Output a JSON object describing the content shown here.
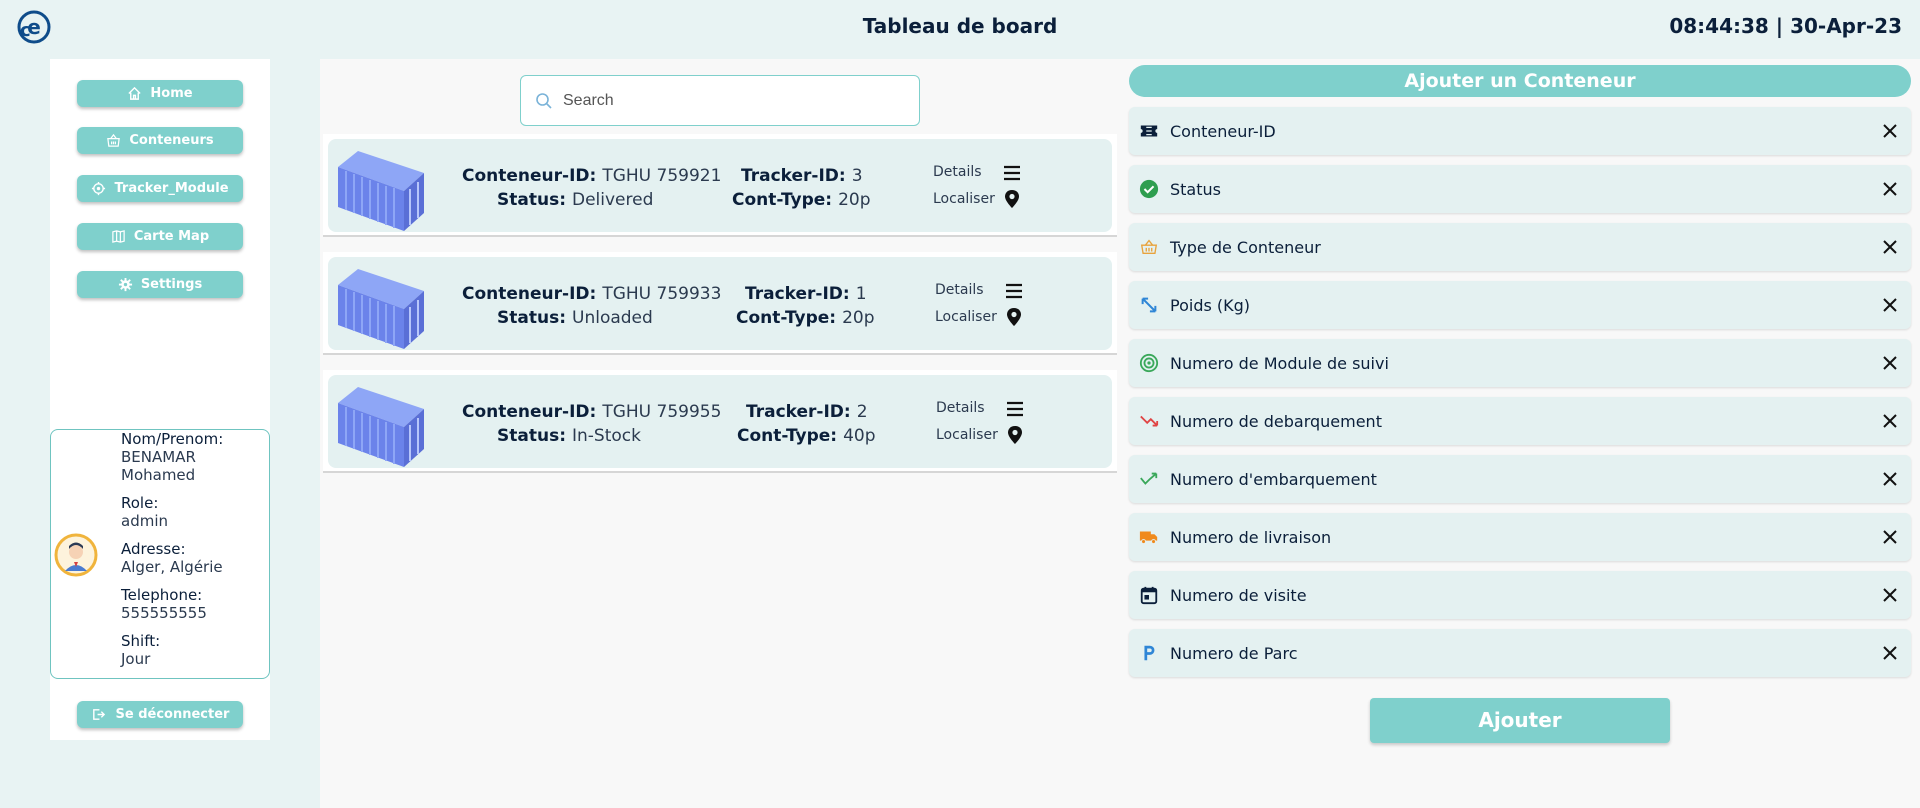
{
  "header": {
    "title": "Tableau de board",
    "clock": "08:44:38 | 30-Apr-23"
  },
  "sidebar": {
    "nav": [
      {
        "label": "Home",
        "icon": "home-icon"
      },
      {
        "label": "Conteneurs",
        "icon": "basket-icon"
      },
      {
        "label": "Tracker_Module",
        "icon": "target-icon"
      },
      {
        "label": "Carte Map",
        "icon": "map-icon"
      },
      {
        "label": "Settings",
        "icon": "gear-icon"
      }
    ],
    "profile": {
      "name_label": "Nom/Prenom:",
      "name_value": "BENAMAR Mohamed",
      "role_label": "Role:",
      "role_value": "admin",
      "address_label": "Adresse:",
      "address_value": "Alger, Algérie",
      "phone_label": "Telephone:",
      "phone_value": "555555555",
      "shift_label": "Shift:",
      "shift_value": "Jour"
    },
    "logout_label": "Se déconnecter"
  },
  "search": {
    "placeholder": "Search"
  },
  "containers": {
    "id_label": "Conteneur-ID:",
    "status_label": "Status:",
    "tracker_label": "Tracker-ID:",
    "type_label": "Cont-Type:",
    "details_label": "Details",
    "locate_label": "Localiser",
    "items": [
      {
        "id": "TGHU 759921",
        "status": "Delivered",
        "tracker": "3",
        "type": "20p"
      },
      {
        "id": "TGHU 759933",
        "status": "Unloaded",
        "tracker": "1",
        "type": "20p"
      },
      {
        "id": "TGHU 759955",
        "status": "In-Stock",
        "tracker": "2",
        "type": "40p"
      }
    ]
  },
  "form": {
    "title": "Ajouter un Conteneur",
    "fields": [
      {
        "label": "Conteneur-ID",
        "icon": "ticket-icon",
        "color": "#0b1f3a"
      },
      {
        "label": "Status",
        "icon": "check-circle-icon",
        "color": "#2e9e4f"
      },
      {
        "label": "Type de Conteneur",
        "icon": "basket-icon",
        "color": "#e8a33d"
      },
      {
        "label": "Poids (Kg)",
        "icon": "diagonal-arrows-icon",
        "color": "#2f86d6"
      },
      {
        "label": "Numero de Module de suivi",
        "icon": "radar-icon",
        "color": "#3aa85a"
      },
      {
        "label": "Numero de debarquement",
        "icon": "trend-down-icon",
        "color": "#e04444"
      },
      {
        "label": "Numero d'embarquement",
        "icon": "trend-up-icon",
        "color": "#3aa85a"
      },
      {
        "label": "Numero de livraison",
        "icon": "truck-icon",
        "color": "#f08a1c"
      },
      {
        "label": "Numero de visite",
        "icon": "calendar-icon",
        "color": "#0b1f3a"
      },
      {
        "label": "Numero de Parc",
        "icon": "parking-icon",
        "color": "#2f86d6"
      }
    ],
    "submit_label": "Ajouter"
  },
  "colors": {
    "accent": "#7fd0cc",
    "background": "#e8f3f3",
    "card": "#e4f1f1",
    "text": "#0b1f3a"
  }
}
